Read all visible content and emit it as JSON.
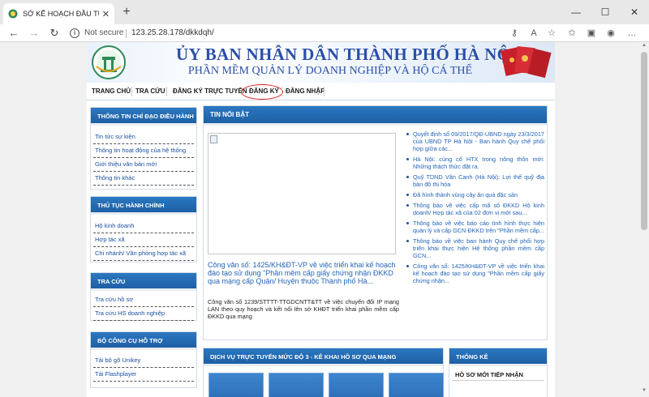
{
  "browser": {
    "tab_title": "SỞ KẾ HOẠCH ĐẦU TƯ TP HÀ NỘ",
    "security_label": "Not secure",
    "url": "123.25.28.178/dkkdqh/"
  },
  "banner": {
    "title": "ỦY BAN NHÂN DÂN THÀNH PHỐ HÀ NỘI",
    "subtitle": "PHẦN MỀM QUẢN LÝ DOANH NGHIỆP VÀ HỘ CÁ THỂ"
  },
  "menu": [
    "TRANG CHỦ",
    "TRA CỨU",
    "ĐĂNG KÝ TRỰC TUYẾN",
    "ĐĂNG KÝ",
    "ĐĂNG NHẬP"
  ],
  "left_boxes": [
    {
      "title": "THÔNG TIN CHỈ ĐẠO ĐIỀU HÀNH",
      "items": [
        "Tin tức sự kiện",
        "Thông tin hoạt động của hệ thống",
        "Giới thiệu văn bản mới",
        "Thông tin khác"
      ]
    },
    {
      "title": "THỦ TỤC HÀNH CHÍNH",
      "items": [
        "Hộ kinh doanh",
        "Hợp tác xã",
        "Chi nhánh/ Văn phòng hợp tác xã"
      ]
    },
    {
      "title": "TRA CỨU",
      "items": [
        "Tra cứu hồ sơ",
        "Tra cứu HS doanh nghiệp"
      ]
    },
    {
      "title": "BỘ CÔNG CỤ HỖ TRỢ",
      "items": [
        "Tải bộ gõ Unikey",
        "Tải Flashplayer"
      ]
    }
  ],
  "news": {
    "title": "TIN NỔI BẬT",
    "featured_title": "Công văn số: 1425/KH&ĐT-VP về việc triển khai kế hoạch đào tạo sử dụng \"Phần mềm cấp giấy chứng nhận ĐKKD qua mạng cấp Quận/ Huyện thuộc Thành phố Hà...",
    "featured_desc": "Công văn số 1239/STTTT-TTGDCNTT&TT về việc chuyển đổi IP mạng LAN theo quy hoạch và kết nối lên sở KHĐT triển khai phần mềm cấp ĐKKD qua mạng",
    "items": [
      "Quyết định số 09/2017/QĐ-UBND ngày 23/3/2017 của UBND TP Hà Nội - Ban hành Quy chế phối hợp giữa các...",
      "Hà Nội: cùng cố HTX trong nông thôn mới: Những thách thức đặt ra.",
      "Quỹ TDND Vân Canh (Hà Nội): Lợi thế quỹ địa bàn đô thị hóa",
      "Đã hình thành vùng cây ăn quả đặc sản",
      "Thông báo về việc cấp mã số ĐKKD Hộ kinh doanh/ Hợp tác xã của 02 đơn vị mới sau...",
      "Thông báo về việc báo cáo tình hình thực hiện quản lý và cấp GCN ĐKKD trên \"Phần mềm cấp...",
      "Thông báo về việc ban hành Quy chế phối hợp triển khai thực hiện Hệ thống phần mềm cấp GCN...",
      "Công văn số: 1425/KH&ĐT-VP về việc triển khai kế hoạch đào tạo sử dụng \"Phần mềm cấp giấy chứng nhận..."
    ]
  },
  "services": {
    "title": "DỊCH VỤ TRỰC TUYẾN MỨC ĐỘ 3 - KÊ KHAI HỒ SƠ QUA MẠNG"
  },
  "stats": {
    "title": "THỐNG KÊ",
    "subtitle": "HỒ SƠ MỚI TIẾP NHẬN"
  }
}
